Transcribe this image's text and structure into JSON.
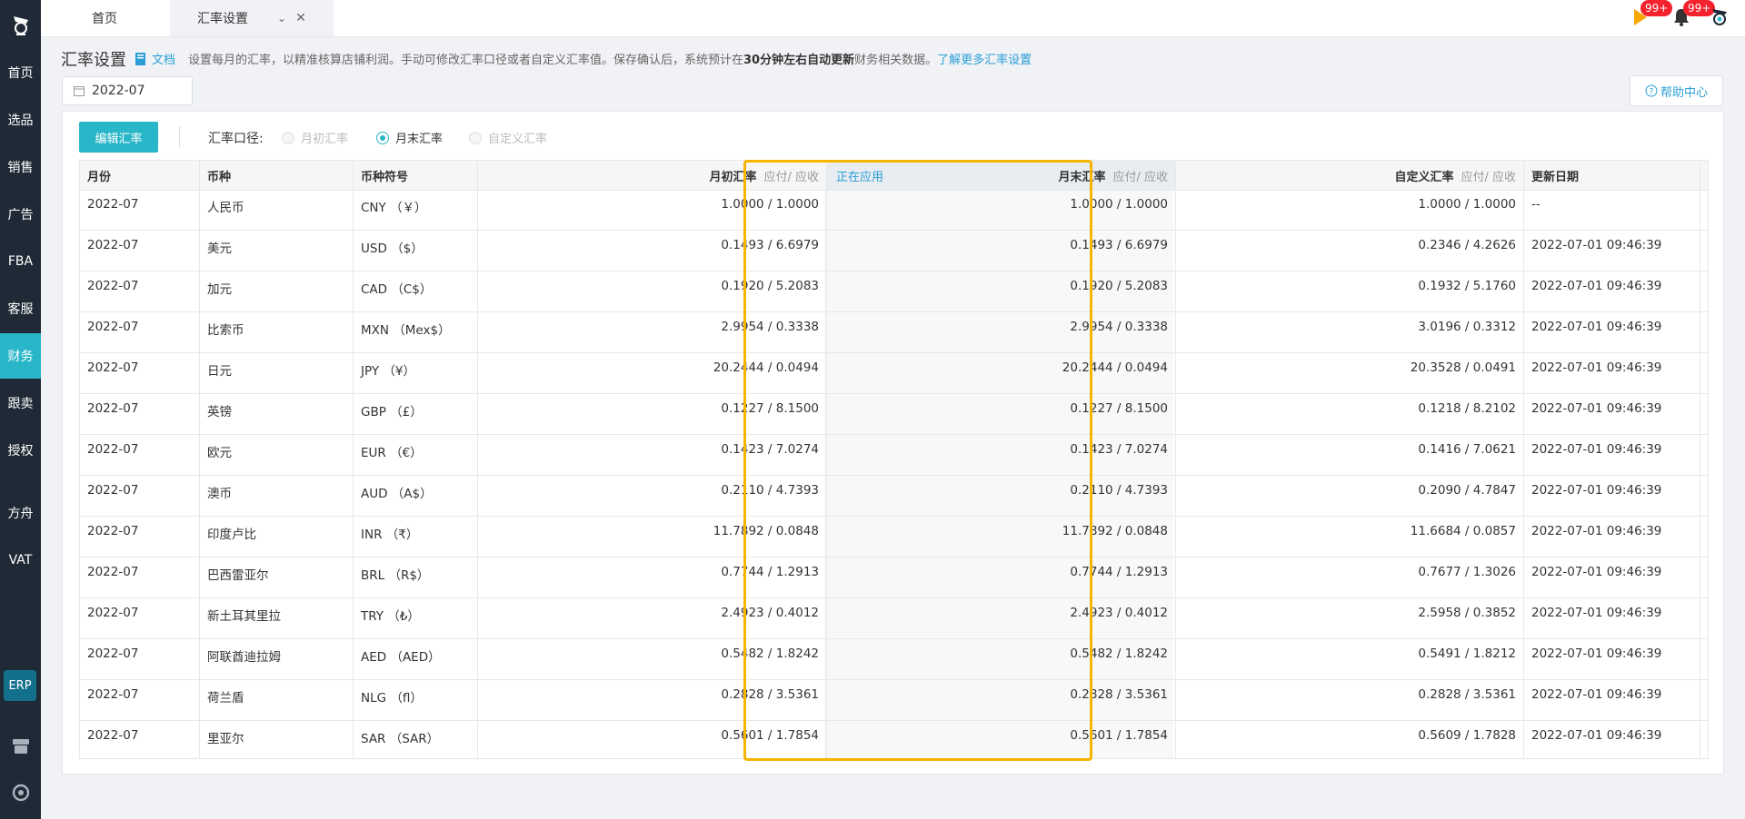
{
  "sidebar": {
    "items": [
      {
        "label": "首页",
        "active": false
      },
      {
        "label": "选品",
        "active": false
      },
      {
        "label": "销售",
        "active": false
      },
      {
        "label": "广告",
        "active": false
      },
      {
        "label": "FBA",
        "active": false
      },
      {
        "label": "客服",
        "active": false
      },
      {
        "label": "财务",
        "active": true
      },
      {
        "label": "跟卖",
        "active": false
      },
      {
        "label": "授权",
        "active": false
      },
      {
        "label": "方舟",
        "active": false
      },
      {
        "label": "VAT",
        "active": false
      }
    ],
    "erp_label": "ERP",
    "active_color": "#29b6c8",
    "bg_color": "#1f2a36"
  },
  "topbar": {
    "tabs": [
      {
        "label": "首页"
      },
      {
        "label": "汇率设置"
      }
    ],
    "flag_badge": "99+",
    "bell_badge": "99+"
  },
  "header": {
    "title": "汇率设置",
    "doc_link": "文档",
    "desc_1": "设置每月的汇率，以精准核算店铺利润。手动可修改汇率口径或者自定义汇率值。保存确认后，系统预计在",
    "desc_bold": "30分钟左右自动更新",
    "desc_2": "财务相关数据。",
    "desc_link": "了解更多汇率设置",
    "month_value": "2022-07",
    "help_label": "帮助中心"
  },
  "toolbar": {
    "edit_button": "编辑汇率",
    "caliber_label": "汇率口径:",
    "options": [
      {
        "label": "月初汇率",
        "state": "disabled"
      },
      {
        "label": "月末汇率",
        "state": "checked"
      },
      {
        "label": "自定义汇率",
        "state": "disabled"
      }
    ]
  },
  "table": {
    "columns": {
      "month": "月份",
      "currency": "币种",
      "symbol": "币种符号",
      "begin_rate": "月初汇率",
      "end_rate": "月末汇率",
      "custom_rate": "自定义汇率",
      "updated": "更新日期",
      "payable_receivable": "应付/ 应收",
      "applying": "正在应用"
    },
    "rows": [
      {
        "month": "2022-07",
        "currency": "人民币",
        "symbol": "CNY （￥）",
        "begin": "1.0000  /  1.0000",
        "end": "1.0000 / 1.0000",
        "custom": "1.0000 / 1.0000",
        "updated": "--"
      },
      {
        "month": "2022-07",
        "currency": "美元",
        "symbol": "USD （$）",
        "begin": "0.1493  /  6.6979",
        "end": "0.1493 / 6.6979",
        "custom": "0.2346 / 4.2626",
        "updated": "2022-07-01 09:46:39"
      },
      {
        "month": "2022-07",
        "currency": "加元",
        "symbol": "CAD （C$）",
        "begin": "0.1920  /  5.2083",
        "end": "0.1920 / 5.2083",
        "custom": "0.1932 / 5.1760",
        "updated": "2022-07-01 09:46:39"
      },
      {
        "month": "2022-07",
        "currency": "比索币",
        "symbol": "MXN （Mex$）",
        "begin": "2.9954  /  0.3338",
        "end": "2.9954 / 0.3338",
        "custom": "3.0196 / 0.3312",
        "updated": "2022-07-01 09:46:39"
      },
      {
        "month": "2022-07",
        "currency": "日元",
        "symbol": "JPY （¥）",
        "begin": "20.2444  /  0.0494",
        "end": "20.2444 / 0.0494",
        "custom": "20.3528 / 0.0491",
        "updated": "2022-07-01 09:46:39"
      },
      {
        "month": "2022-07",
        "currency": "英镑",
        "symbol": "GBP （£）",
        "begin": "0.1227  /  8.1500",
        "end": "0.1227 / 8.1500",
        "custom": "0.1218 / 8.2102",
        "updated": "2022-07-01 09:46:39"
      },
      {
        "month": "2022-07",
        "currency": "欧元",
        "symbol": "EUR （€）",
        "begin": "0.1423  /  7.0274",
        "end": "0.1423 / 7.0274",
        "custom": "0.1416 / 7.0621",
        "updated": "2022-07-01 09:46:39"
      },
      {
        "month": "2022-07",
        "currency": "澳币",
        "symbol": "AUD （A$）",
        "begin": "0.2110  /  4.7393",
        "end": "0.2110 / 4.7393",
        "custom": "0.2090 / 4.7847",
        "updated": "2022-07-01 09:46:39"
      },
      {
        "month": "2022-07",
        "currency": "印度卢比",
        "symbol": "INR （₹）",
        "begin": "11.7892  /  0.0848",
        "end": "11.7892 / 0.0848",
        "custom": "11.6684 / 0.0857",
        "updated": "2022-07-01 09:46:39"
      },
      {
        "month": "2022-07",
        "currency": "巴西雷亚尔",
        "symbol": "BRL （R$）",
        "begin": "0.7744  /  1.2913",
        "end": "0.7744 / 1.2913",
        "custom": "0.7677 / 1.3026",
        "updated": "2022-07-01 09:46:39"
      },
      {
        "month": "2022-07",
        "currency": "新土耳其里拉",
        "symbol": "TRY （₺）",
        "begin": "2.4923  /  0.4012",
        "end": "2.4923 / 0.4012",
        "custom": "2.5958 / 0.3852",
        "updated": "2022-07-01 09:46:39"
      },
      {
        "month": "2022-07",
        "currency": "阿联酋迪拉姆",
        "symbol": "AED （AED）",
        "begin": "0.5482  /  1.8242",
        "end": "0.5482 / 1.8242",
        "custom": "0.5491 / 1.8212",
        "updated": "2022-07-01 09:46:39"
      },
      {
        "month": "2022-07",
        "currency": "荷兰盾",
        "symbol": "NLG （fl）",
        "begin": "0.2828  /  3.5361",
        "end": "0.2828 / 3.5361",
        "custom": "0.2828 / 3.5361",
        "updated": "2022-07-01 09:46:39"
      },
      {
        "month": "2022-07",
        "currency": "里亚尔",
        "symbol": "SAR （SAR）",
        "begin": "0.5601  /  1.7854",
        "end": "0.5601 / 1.7854",
        "custom": "0.5609 / 1.7828",
        "updated": "2022-07-01 09:46:39"
      }
    ]
  },
  "colors": {
    "accent": "#29b6c8",
    "link": "#2a9fd6",
    "highlight_border": "#f7b500",
    "badge": "#f5222d"
  }
}
